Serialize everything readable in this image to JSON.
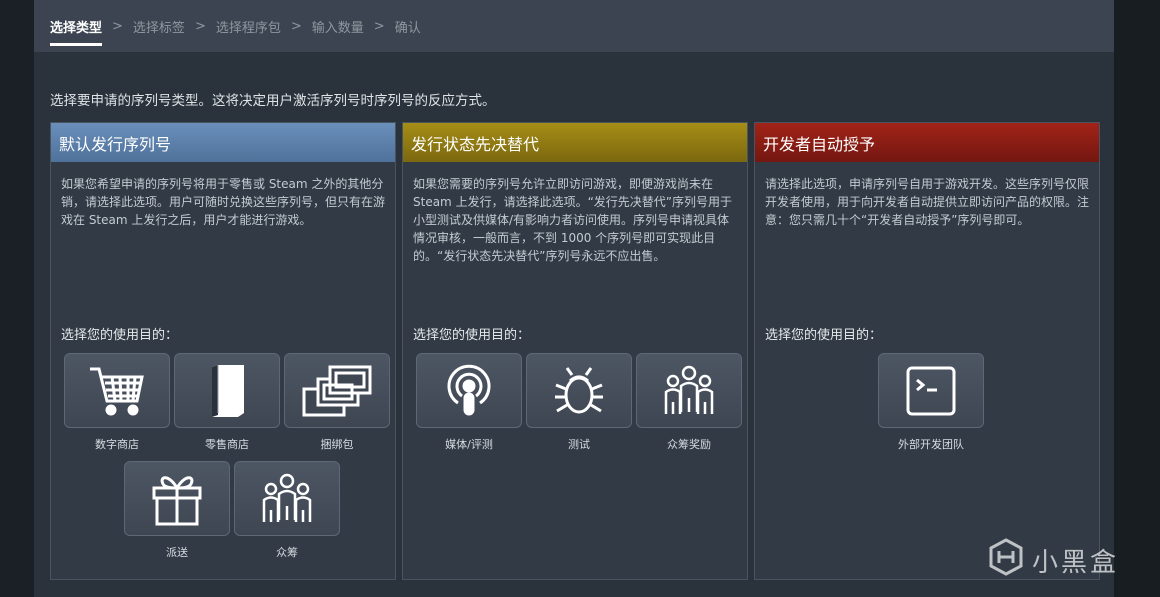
{
  "breadcrumb": {
    "steps": [
      "选择类型",
      "选择标签",
      "选择程序包",
      "输入数量",
      "确认"
    ],
    "separator": ">"
  },
  "intro_text": "选择要申请的序列号类型。这将决定用户激活序列号时序列号的反应方式。",
  "columns": [
    {
      "title": "默认发行序列号",
      "header_color": "#5b7fa8",
      "description": "如果您希望申请的序列号将用于零售或 Steam 之外的其他分销，请选择此选项。用户可随时兑换这些序列号，但只有在游戏在 Steam 上发行之后，用户才能进行游戏。",
      "purpose_label": "选择您的使用目的：",
      "options": [
        {
          "label": "数字商店",
          "icon": "cart-icon"
        },
        {
          "label": "零售商店",
          "icon": "box-icon"
        },
        {
          "label": "捆绑包",
          "icon": "bundle-icon"
        },
        {
          "label": "派送",
          "icon": "gift-icon"
        },
        {
          "label": "众筹",
          "icon": "crowd-icon"
        }
      ]
    },
    {
      "title": "发行状态先决替代",
      "header_color": "#8f7a12",
      "description": "如果您需要的序列号允许立即访问游戏，即便游戏尚未在 Steam 上发行，请选择此选项。“发行先决替代”序列号用于小型测试及供媒体/有影响力者访问使用。序列号申请视具体情况审核，一般而言，不到 1000 个序列号即可实现此目的。“发行状态先决替代”序列号永远不应出售。",
      "purpose_label": "选择您的使用目的：",
      "options": [
        {
          "label": "媒体/评测",
          "icon": "podcast-icon"
        },
        {
          "label": "测试",
          "icon": "bug-icon"
        },
        {
          "label": "众筹奖励",
          "icon": "crowd-icon"
        }
      ]
    },
    {
      "title": "开发者自动授予",
      "header_color": "#8a1d14",
      "description": "请选择此选项，申请序列号自用于游戏开发。这些序列号仅限开发者使用，用于向开发者自动提供立即访问产品的权限。注意：您只需几十个“开发者自动授予”序列号即可。",
      "purpose_label": "选择您的使用目的：",
      "options": [
        {
          "label": "外部开发团队",
          "icon": "terminal-icon"
        }
      ]
    }
  ],
  "watermark": "小黑盒"
}
